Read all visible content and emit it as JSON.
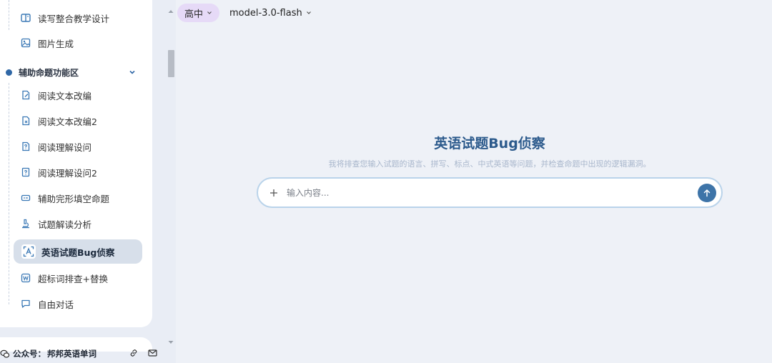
{
  "sidebar": {
    "top_items": [
      {
        "label": "读写整合教学设计",
        "icon": "book-open-icon"
      },
      {
        "label": "图片生成",
        "icon": "image-icon"
      }
    ],
    "section": {
      "label": "辅助命题功能区",
      "expanded": true
    },
    "section_items": [
      {
        "label": "阅读文本改编",
        "icon": "file-edit-icon"
      },
      {
        "label": "阅读文本改编2",
        "icon": "file-edit-icon"
      },
      {
        "label": "阅读理解设问",
        "icon": "file-question-icon"
      },
      {
        "label": "阅读理解设问2",
        "icon": "file-question-icon"
      },
      {
        "label": "辅助完形填空命题",
        "icon": "input-box-icon"
      },
      {
        "label": "试题解读分析",
        "icon": "microscope-icon"
      },
      {
        "label": "英语试题Bug侦察",
        "icon": "scan-text-icon",
        "active": true
      },
      {
        "label": "超标词排查+替换",
        "icon": "word-icon"
      },
      {
        "label": "自由对话",
        "icon": "chat-icon"
      }
    ]
  },
  "footer": {
    "label": "公众号：",
    "name": "邦邦英语单词"
  },
  "topbar": {
    "grade": "高中",
    "model": "model-3.0-flash"
  },
  "main": {
    "title": "英语试题Bug侦察",
    "subtitle": "我将排查您输入试题的语言、拼写、标点、中式英语等问题，并检查命题中出现的逻辑漏洞。",
    "input_placeholder": "输入内容..."
  },
  "colors": {
    "accent": "#3e74a8",
    "title": "#2c5a8c",
    "grade_pill": "#e6daf7",
    "active_item": "#d7dfea"
  }
}
